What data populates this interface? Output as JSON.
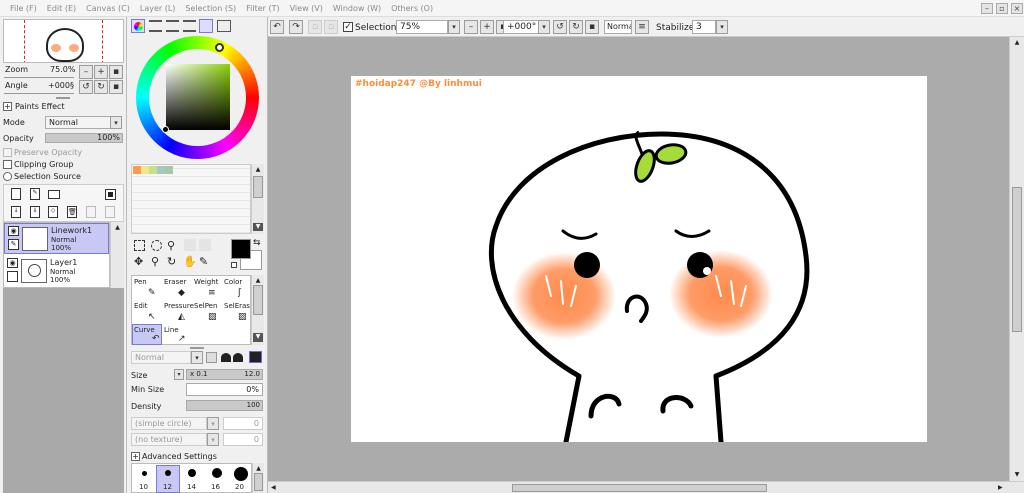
{
  "menu": [
    "File (F)",
    "Edit (E)",
    "Canvas (C)",
    "Layer (L)",
    "Selection (S)",
    "Filter (T)",
    "View (V)",
    "Window (W)",
    "Others (O)"
  ],
  "navigator": {
    "zoom_label": "Zoom",
    "zoom_value": "75.0%",
    "angle_label": "Angle",
    "angle_value": "+000§"
  },
  "layer_props": {
    "paints_effect": "Paints Effect",
    "mode_label": "Mode",
    "mode_value": "Normal",
    "opacity_label": "Opacity",
    "opacity_value": "100%",
    "preserve_opacity": "Preserve Opacity",
    "clipping_group": "Clipping Group",
    "selection_source": "Selection Source"
  },
  "layers": [
    {
      "name": "Linework1",
      "mode": "Normal",
      "opacity": "100%",
      "selected": true
    },
    {
      "name": "Layer1",
      "mode": "Normal",
      "opacity": "100%",
      "selected": false
    }
  ],
  "tools": {
    "row1": [
      "Pen",
      "Eraser",
      "Weight",
      "Color"
    ],
    "row2": [
      "Edit",
      "Pressure",
      "SelPen",
      "SelEras"
    ],
    "row3": [
      "Curve",
      "Line"
    ]
  },
  "brush": {
    "mode_value": "Normal",
    "size_label": "Size",
    "size_mult": "x 0.1",
    "size_value": "12.0",
    "min_size_label": "Min Size",
    "min_size_value": "0%",
    "density_label": "Density",
    "density_value": "100",
    "shape_value": "(simple circle)",
    "shape_num": "0",
    "texture_value": "(no texture)",
    "texture_num": "0",
    "advanced": "Advanced Settings",
    "sizes": [
      "10",
      "12",
      "14",
      "16",
      "20"
    ]
  },
  "toolbar": {
    "selection_label": "Selection",
    "zoom_value": "75%",
    "angle_value": "+000°",
    "blend_value": "Normal",
    "stabilizer_label": "Stabilizer",
    "stabilizer_value": "3"
  },
  "canvas": {
    "watermark": "#hoidap247 @By linhmui"
  },
  "colors": {
    "accent": "#a8a8e8",
    "selected_layer": "#c8c8f4",
    "canvas_bg": "#ababab",
    "watermark": "#ff8c3c",
    "blush": "#ff8a4c",
    "leaf": "#a5dc3a",
    "primary_color": "#000000"
  }
}
